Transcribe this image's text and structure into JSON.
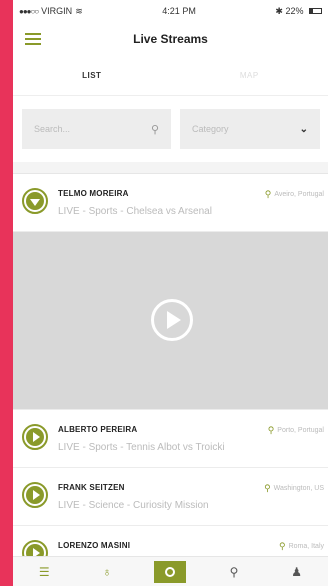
{
  "status": {
    "carrier": "VIRGIN",
    "time": "4:21 PM",
    "battery": "22%"
  },
  "header": {
    "title": "Live Streams"
  },
  "tabs": [
    {
      "label": "LIST"
    },
    {
      "label": "MAP"
    }
  ],
  "search": {
    "placeholder": "Search..."
  },
  "category": {
    "label": "Category"
  },
  "streams": [
    {
      "name": "TELMO MOREIRA",
      "location": "Aveiro, Portugal",
      "desc": "LIVE - Sports - Chelsea vs Arsenal"
    },
    {
      "name": "ALBERTO PEREIRA",
      "location": "Porto, Portugal",
      "desc": "LIVE - Sports - Tennis Albot vs Troicki"
    },
    {
      "name": "FRANK SEITZEN",
      "location": "Washington, US",
      "desc": "LIVE - Science - Curiosity Mission"
    },
    {
      "name": "LORENZO MASINI",
      "location": "Roma, Italy",
      "desc": ""
    }
  ],
  "colors": {
    "accent": "#8a9a2a",
    "background": "#e8335a"
  }
}
